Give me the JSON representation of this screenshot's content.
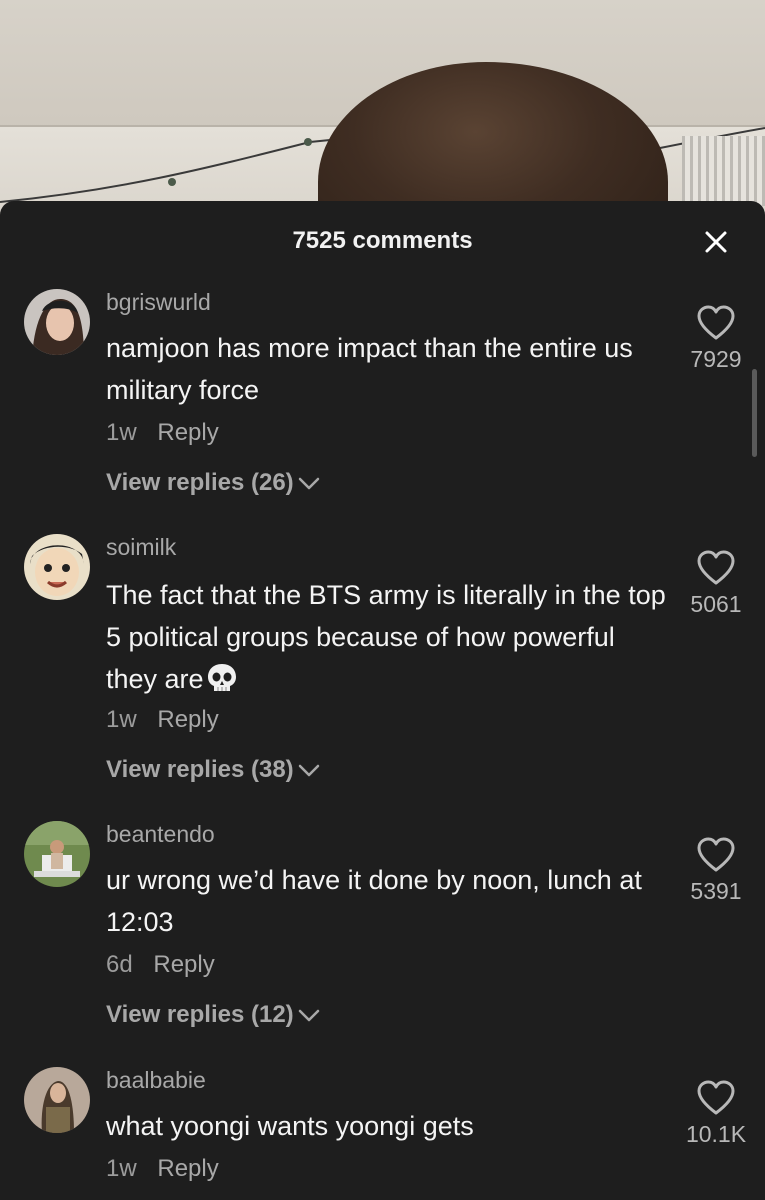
{
  "header": {
    "comment_count_label": "7525 comments"
  },
  "comments": [
    {
      "username": "bgriswurld",
      "text": "namjoon has more impact than the entire us military force",
      "age": "1w",
      "reply_label": "Reply",
      "view_replies_label": "View replies (26)",
      "likes": "7929"
    },
    {
      "username": "soimilk",
      "text": "The fact that the BTS army is literally in the top 5 political groups because of how powerful they are",
      "emoji": "skull",
      "age": "1w",
      "reply_label": "Reply",
      "view_replies_label": "View replies (38)",
      "likes": "5061"
    },
    {
      "username": "beantendo",
      "text": "ur wrong we’d have it done by noon, lunch at 12:03",
      "age": "6d",
      "reply_label": "Reply",
      "view_replies_label": "View replies (12)",
      "likes": "5391"
    },
    {
      "username": "baalbabie",
      "text": "what yoongi wants yoongi gets",
      "age": "1w",
      "reply_label": "Reply",
      "likes": "10.1K"
    }
  ],
  "colors": {
    "sheet_background": "#1e1e1e",
    "primary_text": "#f4f4f4",
    "secondary_text": "#a8a8a8"
  },
  "icons": {
    "close": "close-icon",
    "like": "heart-outline-icon",
    "expand": "chevron-down-icon"
  }
}
